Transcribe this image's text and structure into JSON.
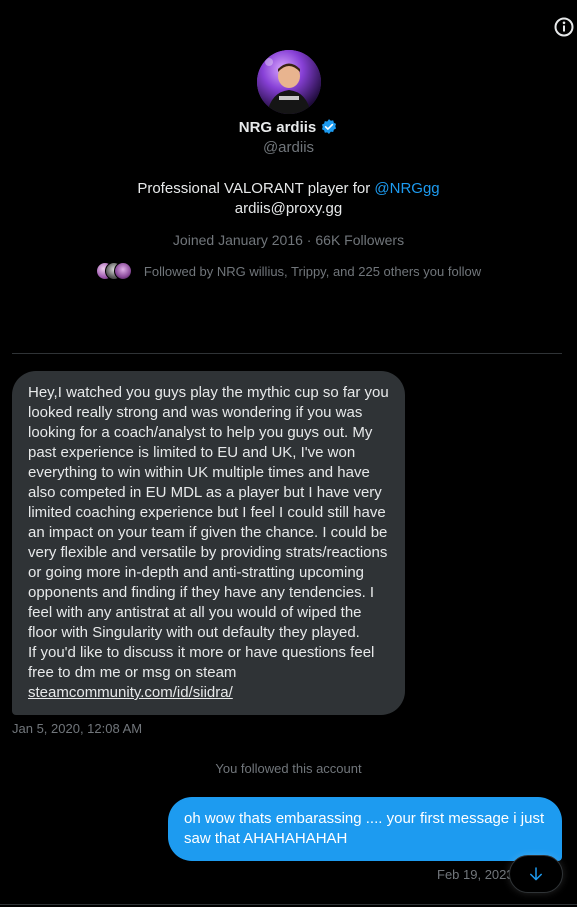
{
  "profile": {
    "display_name": "NRG ardiis",
    "handle": "@ardiis",
    "bio_text": "Professional VALORANT player for ",
    "bio_mention": "@NRGgg",
    "bio_email": "ardiis@proxy.gg",
    "joined": "Joined January 2016",
    "separator": " · ",
    "followers": "66K Followers",
    "followed_by": "Followed by NRG willius, Trippy, and 225 others you follow",
    "verified": true
  },
  "messages": {
    "incoming": {
      "lines": [
        "Hey,I watched you guys play the mythic cup so far you looked really strong and was wondering if you was looking for a coach/analyst to help you guys out. My past experience is limited to EU and UK, I've won everything to win within UK multiple times and have also competed in EU MDL as a player but I have very limited coaching experience but I feel I could still have an impact on your team if given the chance. I could be very flexible and versatile by providing strats/reactions or going more in-depth and anti-stratting upcoming opponents and finding if they have any tendencies. I feel with any antistrat at all you would of wiped the floor with Singularity with out defaulty they played.",
        "If you'd like to discuss it more or have questions feel free to dm me or msg on steam"
      ],
      "link": "steamcommunity.com/id/siidra/",
      "timestamp": "Jan 5, 2020, 12:08 AM"
    },
    "system_note": "You followed this account",
    "outgoing": {
      "text": "oh wow thats embarassing .... your first message i just saw that AHAHAHAHAH",
      "timestamp": "Feb 19, 2023"
    }
  },
  "icons": {
    "info": "info-icon",
    "verified": "verified-badge-icon",
    "scroll_down": "arrow-down-icon"
  },
  "colors": {
    "background": "#000000",
    "accent": "#1d9bf0",
    "incoming_bubble": "#2f3336",
    "secondary_text": "#71767b",
    "primary_text": "#e7e9ea"
  }
}
